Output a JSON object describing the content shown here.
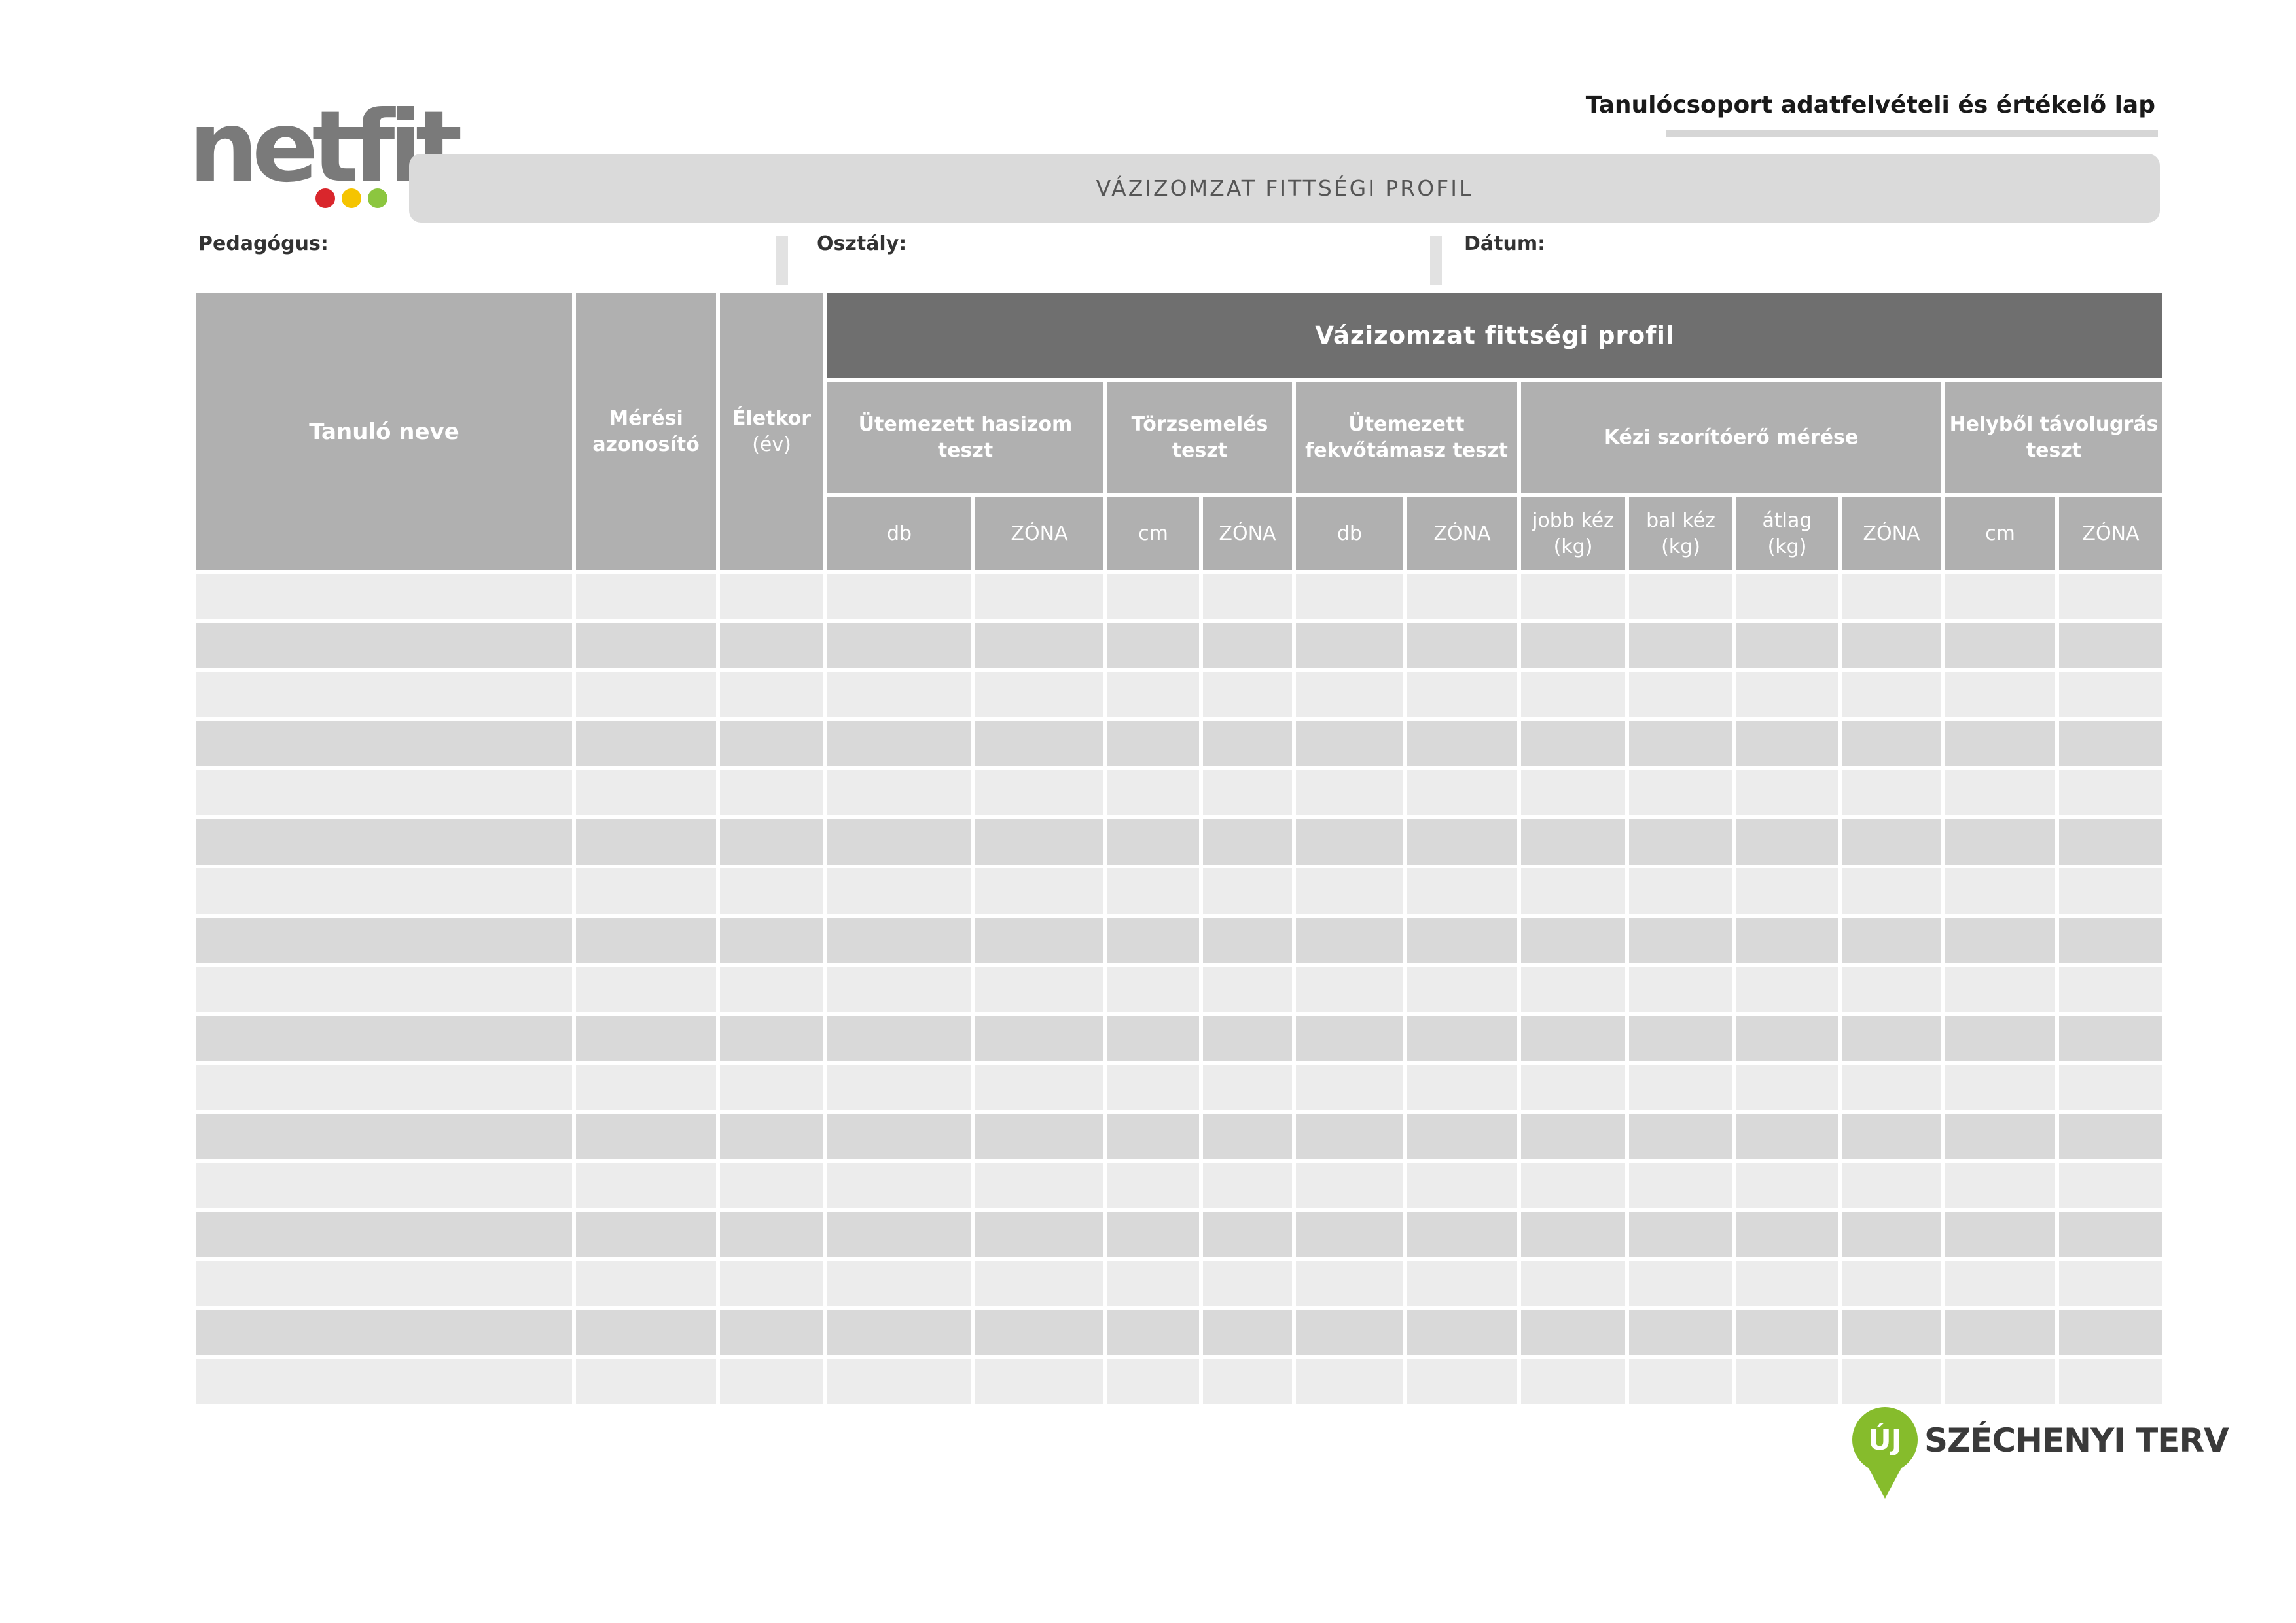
{
  "logo": {
    "text": "netfit",
    "dot_colors": [
      "#d9262c",
      "#f5c400",
      "#8cc63f"
    ]
  },
  "document_title": "Tanulócsoport adatfelvételi és értékelő lap",
  "banner_title": "VÁZIZOMZAT FITTSÉGI PROFIL",
  "fields": {
    "teacher": "Pedagógus:",
    "class": "Osztály:",
    "date": "Dátum:"
  },
  "table": {
    "main_header": "Vázizomzat fittségi profil",
    "col_student_name": "Tanuló neve",
    "col_measure_id": [
      "Mérési",
      "azonosító"
    ],
    "col_age": [
      "Életkor",
      "(év)"
    ],
    "tests": {
      "curl_up": [
        "Ütemezett hasizom",
        "teszt"
      ],
      "trunk_lift": [
        "Törzsemelés",
        "teszt"
      ],
      "push_up": [
        "Ütemezett",
        "fekvőtámasz teszt"
      ],
      "handgrip": "Kézi szorítóerő mérése",
      "long_jump": [
        "Helyből távolugrás",
        "teszt"
      ]
    },
    "units": {
      "db": "db",
      "zona": "ZÓNA",
      "cm": "cm",
      "right_hand": [
        "jobb kéz",
        "(kg)"
      ],
      "left_hand": [
        "bal kéz",
        "(kg)"
      ],
      "average": [
        "átlag",
        "(kg)"
      ]
    },
    "data_rows": 17
  },
  "footer_logo": {
    "pin_text": "ÚJ",
    "text": "SZÉCHENYI TERV",
    "color": "#86bc2c"
  },
  "colors": {
    "header_gray": "#b0b0b0",
    "header_dark": "#6f6f6f",
    "row_light": "#ececec",
    "row_dark": "#d9d9d9"
  }
}
